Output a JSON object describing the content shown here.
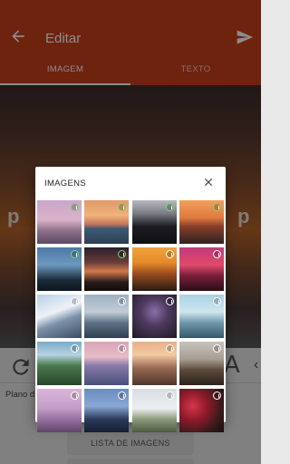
{
  "appbar": {
    "title": "Editar",
    "back_icon": "arrow-back-icon",
    "send_icon": "send-icon"
  },
  "tabs": [
    {
      "label": "IMAGEM",
      "selected": true
    },
    {
      "label": "TEXTO",
      "selected": false
    }
  ],
  "tools": {
    "plano_label": "Plano d",
    "list_button": "LISTA DE IMAGENS",
    "font_glyph": "A",
    "caret": "‹"
  },
  "preview": {
    "left_text": "p",
    "right_text": "p"
  },
  "dialog": {
    "title": "IMAGENS",
    "close_icon": "close-icon",
    "images": [
      {
        "name": "pink-hills-dusk",
        "bg": "linear-gradient(180deg,#c9a6c9 0%,#d9b3c7 45%,#8e6f8a 70%,#5a4a64 100%)",
        "green": true
      },
      {
        "name": "sunset-boat-sea",
        "bg": "linear-gradient(180deg,#e09a6a 0%,#f0b27a 35%,#c7745a 55%,#3d5a74 65%,#2c3f55 100%)",
        "green": true
      },
      {
        "name": "silhouette-reading",
        "bg": "linear-gradient(180deg,#b7b9bf 0%,#7a7d84 30%,#1c1c22 60%,#0e0e12 100%)",
        "green": true
      },
      {
        "name": "orange-sunset-shore",
        "bg": "linear-gradient(180deg,#f1a05c 0%,#e07a3f 40%,#8a3f2a 60%,#2d2222 100%)",
        "green": true
      },
      {
        "name": "hand-silhouette-sky",
        "bg": "linear-gradient(180deg,#4b79a6 0%,#6d98bf 40%,#1a2a38 75%,#0e1620 100%)",
        "green": true
      },
      {
        "name": "person-arms-open",
        "bg": "linear-gradient(180deg,#2a1f2d 0%,#6b3d3a 35%,#d07a4a 55%,#2a1a1a 80%,#120c0c 100%)",
        "green": true
      },
      {
        "name": "golden-sunset",
        "bg": "linear-gradient(180deg,#f0a23a 0%,#e58a2a 35%,#9b4d1e 60%,#281a14 100%)",
        "green": false
      },
      {
        "name": "magenta-tower",
        "bg": "linear-gradient(180deg,#c23a7a 0%,#e04a6a 40%,#7a1e3a 65%,#2a0e18 100%)",
        "green": false
      },
      {
        "name": "snowy-mountain",
        "bg": "linear-gradient(160deg,#b8d0e8 0%,#eef2f6 40%,#7d93ab 60%,#3a4b60 100%)",
        "green": false
      },
      {
        "name": "lighthouse-bay",
        "bg": "linear-gradient(180deg,#9cb0c2 0%,#c2ccd6 40%,#5e7286 65%,#2e3e4e 100%)",
        "green": false
      },
      {
        "name": "purple-flowers",
        "bg": "radial-gradient(circle at 50% 40%,#8c6fa8 0%,#4e3a5e 40%,#1e1a26 100%)",
        "green": false
      },
      {
        "name": "misty-lake",
        "bg": "linear-gradient(180deg,#a9d2e4 0%,#cfe6ef 40%,#6f97ab 65%,#34576c 100%)",
        "green": false
      },
      {
        "name": "green-valley",
        "bg": "linear-gradient(180deg,#78a9c9 0%,#b6d3e0 30%,#4a7a4e 55%,#27452b 100%)",
        "green": false
      },
      {
        "name": "pastel-sunset-sea",
        "bg": "linear-gradient(180deg,#d9a4b8 0%,#e6bdc6 35%,#8a7aa8 55%,#46507a 100%)",
        "green": false
      },
      {
        "name": "foggy-sunrise",
        "bg": "linear-gradient(180deg,#e7b08a 0%,#f2c9a2 30%,#9a6a52 60%,#4e362c 100%)",
        "green": false
      },
      {
        "name": "castle-ruins",
        "bg": "linear-gradient(180deg,#c7c3bd 0%,#a89e92 40%,#5c4a3c 65%,#2a221c 100%)",
        "green": false
      },
      {
        "name": "pink-blossoms",
        "bg": "linear-gradient(180deg,#d9b7d8 0%,#c49cc6 45%,#8e6a99 75%,#5e4468 100%)",
        "green": false
      },
      {
        "name": "blue-silhouette-night",
        "bg": "linear-gradient(180deg,#6a8cc0 0%,#89a7d2 40%,#2a3a5c 70%,#161e30 100%)",
        "green": false
      },
      {
        "name": "white-flowers-field",
        "bg": "linear-gradient(180deg,#d8dde2 0%,#eceff2 45%,#8d9a7a 70%,#4c5a3e 100%)",
        "green": false
      },
      {
        "name": "red-roses",
        "bg": "radial-gradient(circle at 30% 40%,#d23848 0%,#8e1a2a 35%,#3a1a1a 70%,#1a0c0c 100%)",
        "green": false
      }
    ]
  }
}
